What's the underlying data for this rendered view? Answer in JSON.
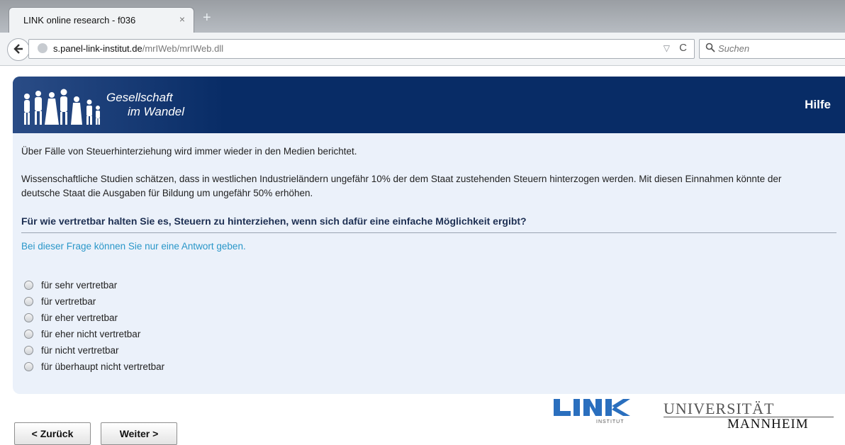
{
  "browser": {
    "tab_title": "LINK online research - f036",
    "tab_close": "×",
    "new_tab": "+",
    "url_host": "s.panel-link-institut.de",
    "url_path": "/mrIWeb/mrIWeb.dll",
    "url_dropdown": "▽",
    "url_reload": "C",
    "search_placeholder": "Suchen"
  },
  "header": {
    "logo_line1": "Gesellschaft",
    "logo_line2": "im Wandel",
    "help_link": "Hilfe"
  },
  "content": {
    "intro1": "Über Fälle von Steuerhinterziehung wird immer wieder in den Medien berichtet.",
    "intro2": "Wissenschaftliche Studien schätzen, dass in westlichen Industrieländern ungefähr 10% der dem Staat zustehenden Steuern hinterzogen werden. Mit diesen Einnahmen könnte der deutsche Staat die Ausgaben für Bildung um ungefähr 50% erhöhen.",
    "question": "Für wie vertretbar halten Sie es, Steuern zu hinterziehen, wenn sich dafür eine einfache Möglichkeit ergibt?",
    "instruction": "Bei dieser Frage können Sie nur eine Antwort geben.",
    "options": [
      "für sehr vertretbar",
      "für vertretbar",
      "für eher vertretbar",
      "für eher nicht vertretbar",
      "für nicht vertretbar",
      "für überhaupt nicht vertretbar"
    ]
  },
  "footer": {
    "back_label": "< Zurück",
    "next_label": "Weiter >",
    "link_logo_sub": "INSTITUT",
    "uni_line1": "UNIVERSITÄT",
    "uni_line2": "MANNHEIM"
  },
  "colors": {
    "header_bg": "#082c66",
    "card_bg": "#ebf1fa",
    "instruction_text": "#2a97c9",
    "link_logo_blue": "#2a6fbe"
  }
}
